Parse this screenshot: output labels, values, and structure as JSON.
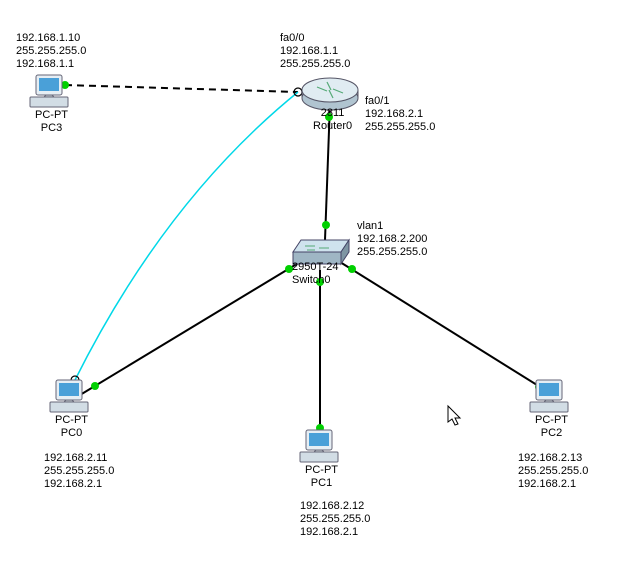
{
  "devices": {
    "pc3": {
      "model": "PC-PT",
      "name": "PC3",
      "ip": "192.168.1.10",
      "mask": "255.255.255.0",
      "gateway": "192.168.1.1"
    },
    "pc0": {
      "model": "PC-PT",
      "name": "PC0",
      "ip": "192.168.2.11",
      "mask": "255.255.255.0",
      "gateway": "192.168.2.1"
    },
    "pc1": {
      "model": "PC-PT",
      "name": "PC1",
      "ip": "192.168.2.12",
      "mask": "255.255.255.0",
      "gateway": "192.168.2.1"
    },
    "pc2": {
      "model": "PC-PT",
      "name": "PC2",
      "ip": "192.168.2.13",
      "mask": "255.255.255.0",
      "gateway": "192.168.2.1"
    },
    "router0": {
      "model": "2811",
      "name": "Router0",
      "interfaces": {
        "fa00": {
          "port": "fa0/0",
          "ip": "192.168.1.1",
          "mask": "255.255.255.0"
        },
        "fa01": {
          "port": "fa0/1",
          "ip": "192.168.2.1",
          "mask": "255.255.255.0"
        }
      }
    },
    "switch0": {
      "model": "2950T-24",
      "name": "Switch0",
      "vlan": {
        "port": "vlan1",
        "ip": "192.168.2.200",
        "mask": "255.255.255.0"
      }
    }
  },
  "colors": {
    "link_up": "#00d000",
    "link_console": "#00d8e8"
  }
}
